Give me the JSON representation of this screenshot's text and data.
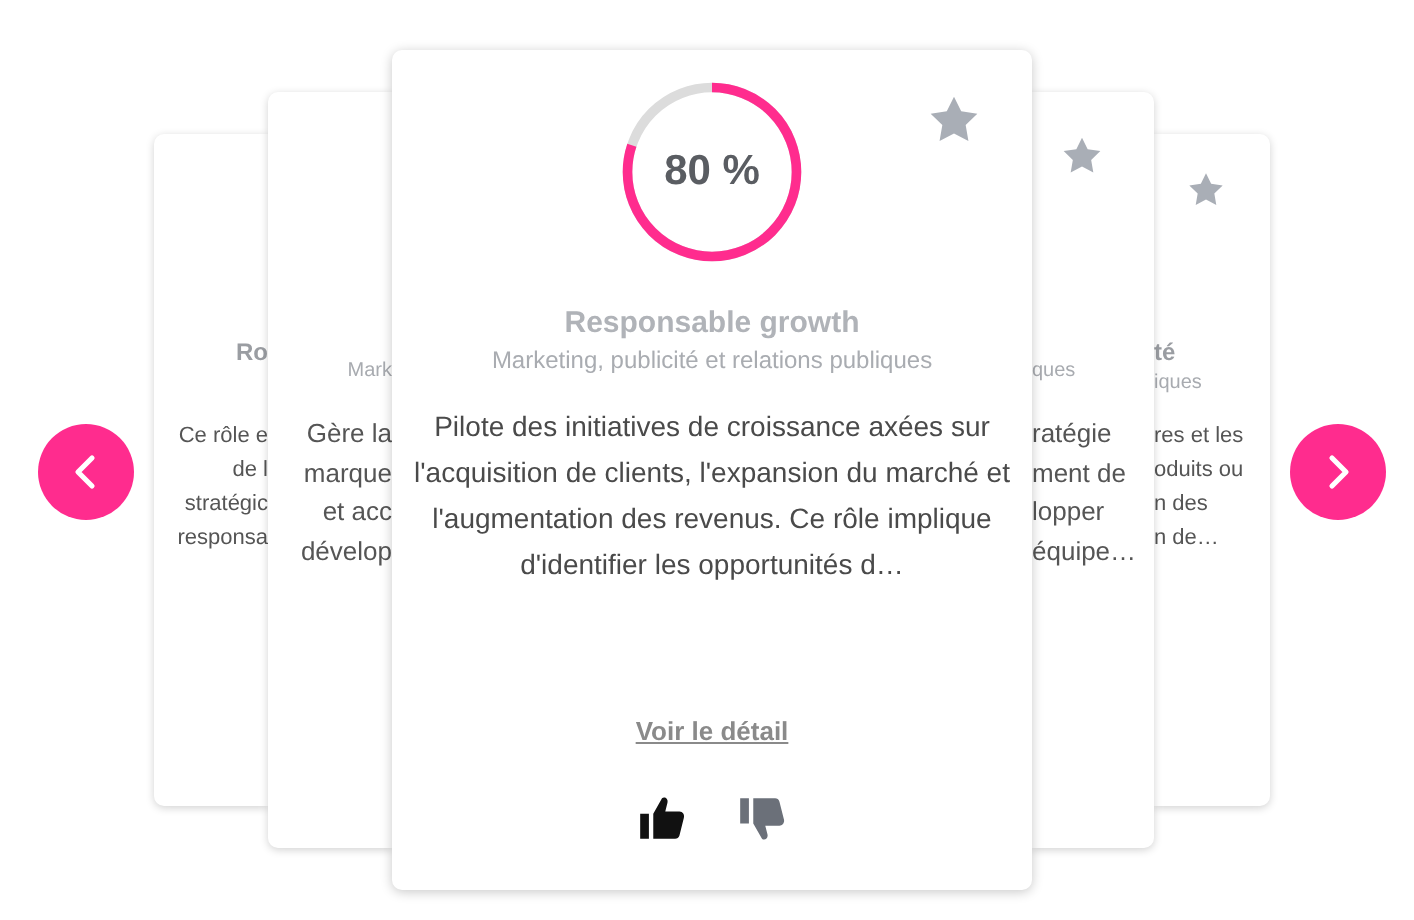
{
  "back_cards": [
    {
      "kind": "outer-left",
      "title": "Ro",
      "lines": [
        "Ce rôle e",
        "de l",
        "stratégic",
        "responsa"
      ]
    },
    {
      "kind": "inner-left",
      "subtitle": "Mark",
      "lines": [
        "Gère la",
        "marque",
        "et acc",
        "dévelop"
      ]
    },
    {
      "kind": "inner-right",
      "favorite": false,
      "subtitle": "ques",
      "lines": [
        "ratégie",
        "ment de",
        "lopper",
        "équipe…"
      ]
    },
    {
      "kind": "outer-right",
      "favorite": false,
      "title": "té",
      "subtitle": "iques",
      "lines": [
        "res et les",
        "oduits ou",
        "n des",
        "n de…"
      ]
    }
  ],
  "active_card": {
    "level": 0.8,
    "score": "80 %",
    "favorite": false,
    "title": "Responsable growth",
    "subtitle": "Marketing, publicité et relations publiques",
    "description": "Pilote des initiatives de croissance axées sur l'acquisition de clients, l'expansion du marché et l'augmentation des revenus. Ce rôle implique d'identifier les opportunités d…",
    "link": "Voir le détail",
    "liked": true,
    "disliked": false
  }
}
